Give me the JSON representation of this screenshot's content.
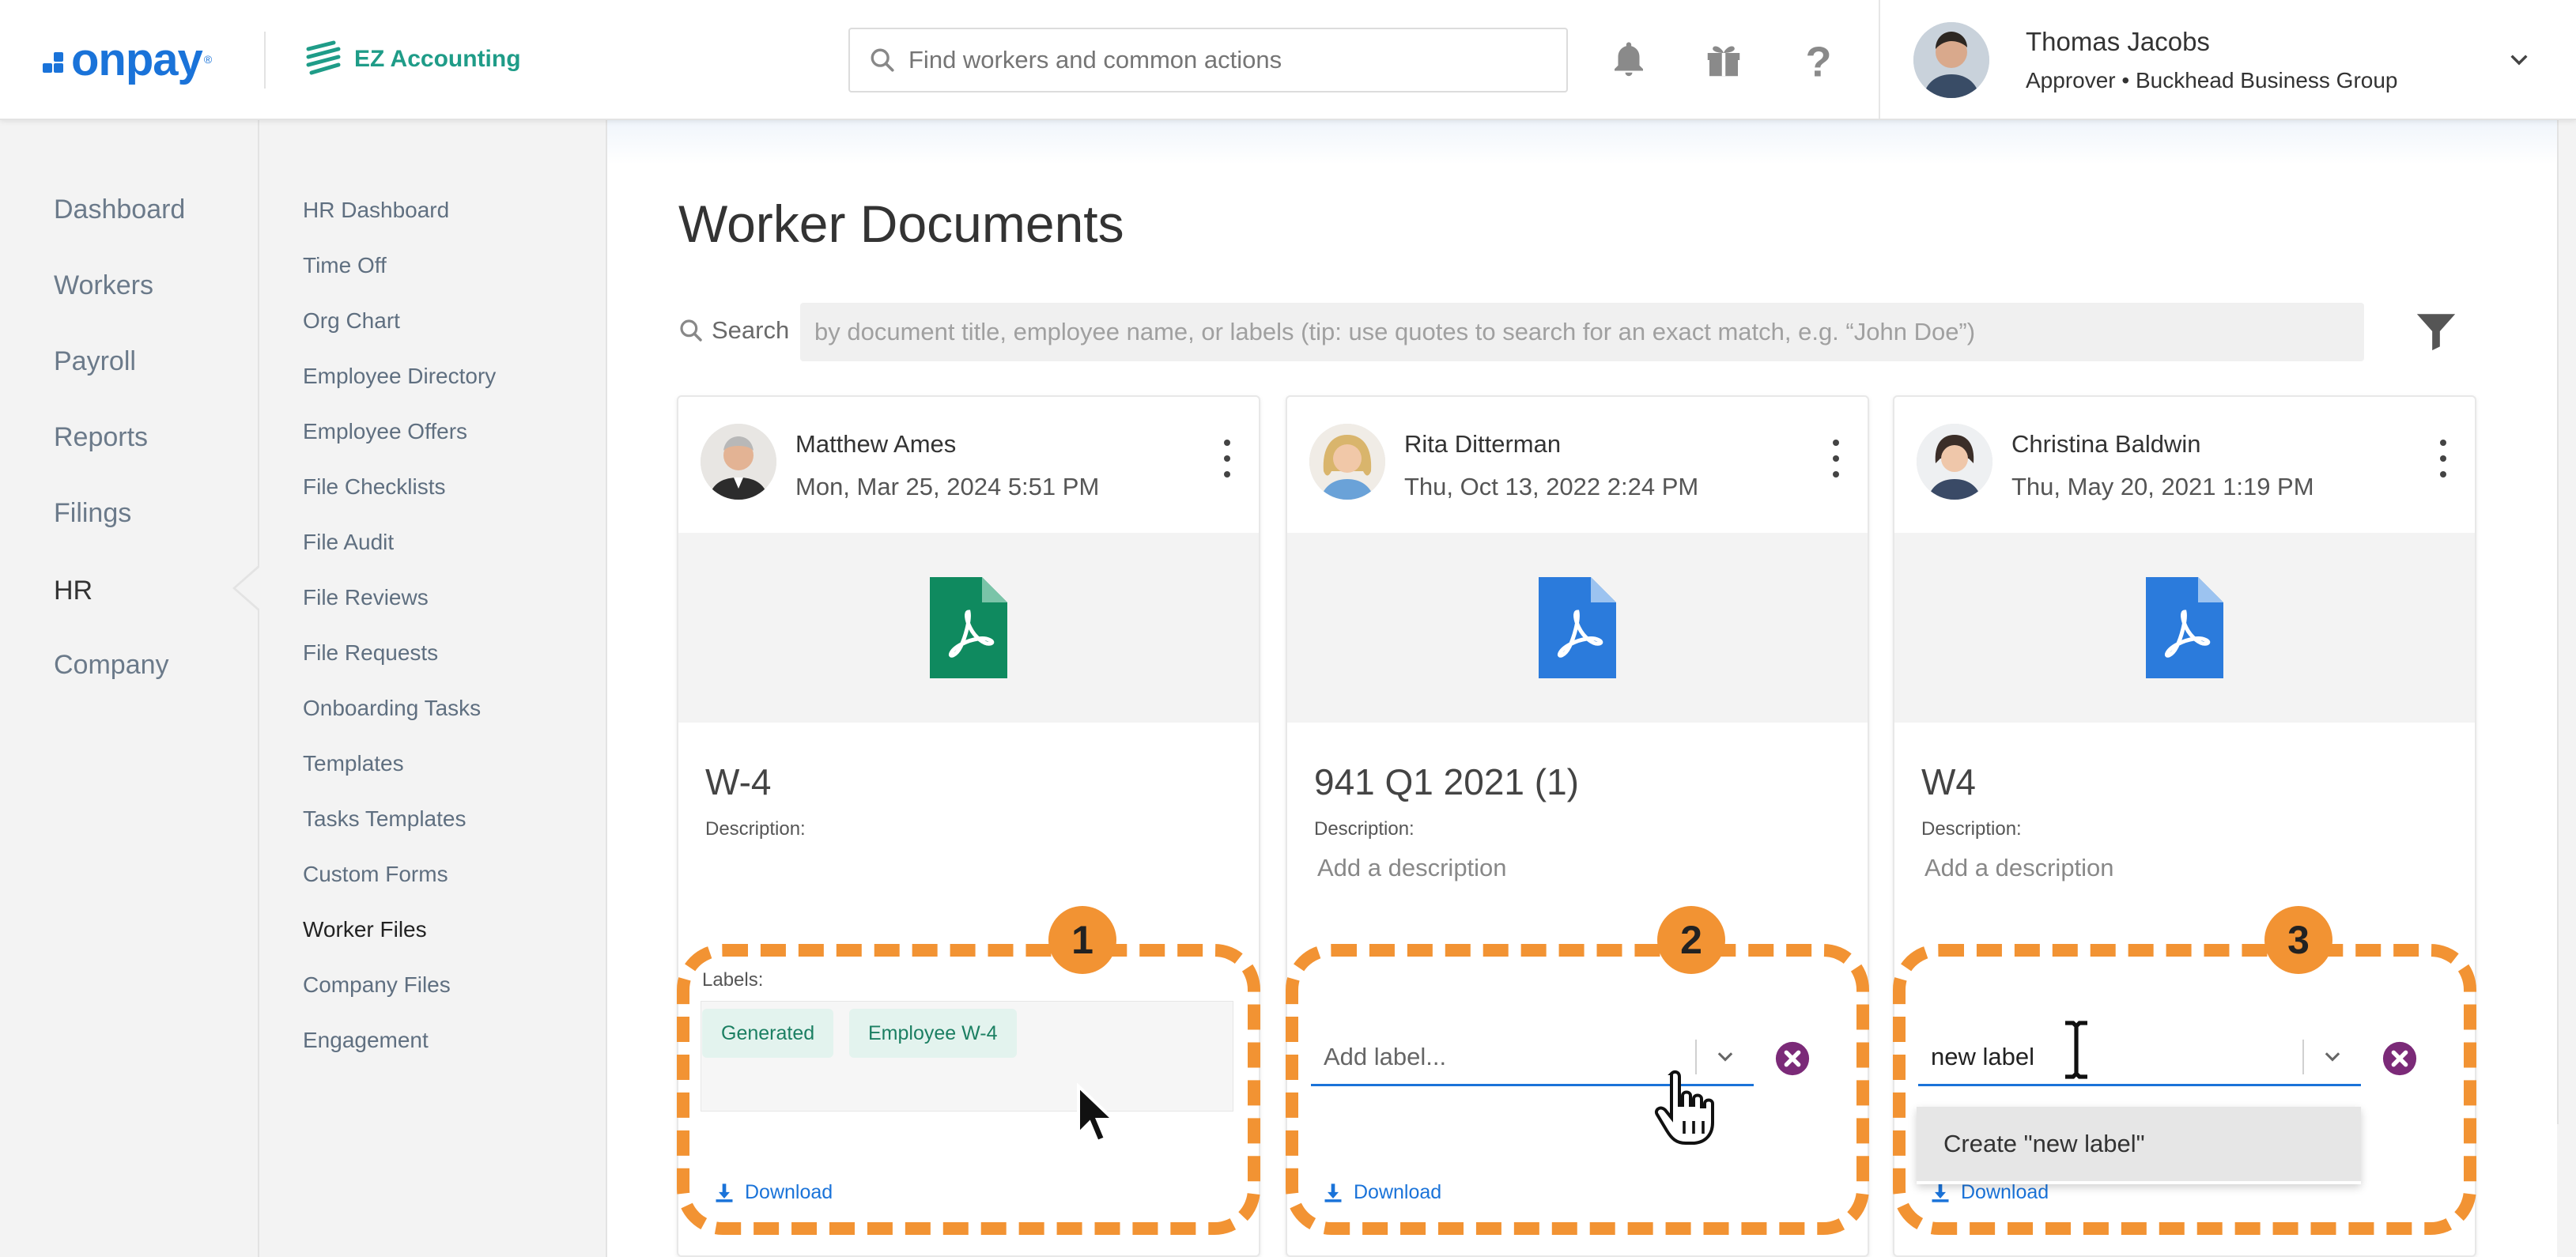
{
  "brand": {
    "onpay": "onpay",
    "ez": "EZ Accounting"
  },
  "topbar": {
    "search_placeholder": "Find workers and common actions",
    "icons": [
      "bell-icon",
      "gift-icon",
      "help-icon"
    ],
    "user": {
      "name": "Thomas Jacobs",
      "role": "Approver • Buckhead Business Group"
    }
  },
  "nav_primary": [
    {
      "label": "Dashboard",
      "active": false
    },
    {
      "label": "Workers",
      "active": false
    },
    {
      "label": "Payroll",
      "active": false
    },
    {
      "label": "Reports",
      "active": false
    },
    {
      "label": "Filings",
      "active": false
    },
    {
      "label": "HR",
      "active": true
    },
    {
      "label": "Company",
      "active": false
    }
  ],
  "nav_secondary": [
    {
      "label": "HR Dashboard",
      "active": false
    },
    {
      "label": "Time Off",
      "active": false
    },
    {
      "label": "Org Chart",
      "active": false
    },
    {
      "label": "Employee Directory",
      "active": false
    },
    {
      "label": "Employee Offers",
      "active": false
    },
    {
      "label": "File Checklists",
      "active": false
    },
    {
      "label": "File Audit",
      "active": false
    },
    {
      "label": "File Reviews",
      "active": false
    },
    {
      "label": "File Requests",
      "active": false
    },
    {
      "label": "Onboarding Tasks",
      "active": false
    },
    {
      "label": "Templates",
      "active": false
    },
    {
      "label": "Tasks Templates",
      "active": false
    },
    {
      "label": "Custom Forms",
      "active": false
    },
    {
      "label": "Worker Files",
      "active": true
    },
    {
      "label": "Company Files",
      "active": false
    },
    {
      "label": "Engagement",
      "active": false
    }
  ],
  "page": {
    "title": "Worker Documents",
    "search_label": "Search",
    "search_placeholder": "by document title, employee name, or labels (tip: use quotes to search for an exact match, e.g. “John Doe”)"
  },
  "cards": [
    {
      "worker": "Matthew Ames",
      "date": "Mon, Mar 25, 2024 5:51 PM",
      "file_color": "#0f8a5f",
      "doc_title": "W-4",
      "description_label": "Description:",
      "description_value": "",
      "labels_label": "Labels:",
      "labels": [
        "Generated",
        "Employee W-4"
      ],
      "download": "Download",
      "callout": "1"
    },
    {
      "worker": "Rita Ditterman",
      "date": "Thu, Oct 13, 2022 2:24 PM",
      "file_color": "#2b7bdc",
      "doc_title": "941 Q1 2021 (1)",
      "description_label": "Description:",
      "description_value": "Add a description",
      "label_input": "Add label...",
      "download": "Download",
      "callout": "2"
    },
    {
      "worker": "Christina Baldwin",
      "date": "Thu, May 20, 2021 1:19 PM",
      "file_color": "#2b7bdc",
      "doc_title": "W4",
      "description_label": "Description:",
      "description_value": "Add a description",
      "label_input": "new label",
      "dropdown_option": "Create \"new label\"",
      "download": "Download",
      "callout": "3"
    }
  ],
  "colors": {
    "accent": "#1a73d9",
    "callout": "#f29333",
    "chip_bg": "#e3f3ee",
    "chip_text": "#1b7f62",
    "clear": "#7b2a78"
  }
}
